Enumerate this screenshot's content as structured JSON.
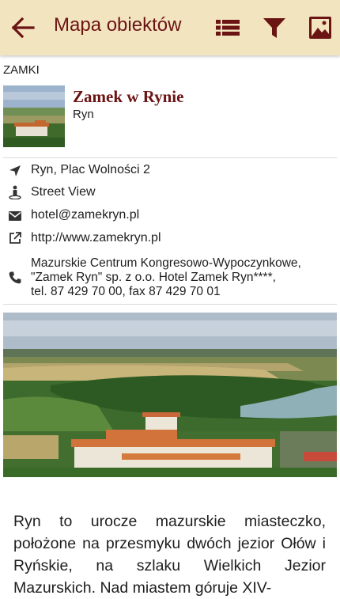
{
  "appbar": {
    "title": "Mapa obiektów",
    "back_icon": "arrow-back-icon",
    "actions": [
      "list-icon",
      "filter-icon",
      "map-image-icon"
    ],
    "bg_color": "#f3e4c0",
    "accent_color": "#6b1414"
  },
  "category": "ZAMKI",
  "object": {
    "name": "Zamek w Rynie",
    "town": "Ryn"
  },
  "info": {
    "address": "Ryn, Plac Wolności 2",
    "street_view": "Street View",
    "email": "hotel@zamekryn.pl",
    "website": "http://www.zamekryn.pl",
    "contact_lines": [
      "Mazurskie Centrum Kongresowo-Wypoczynkowe,",
      "\"Zamek Ryn\" sp. z o.o. Hotel Zamek Ryn****,",
      "tel. 87 429 70 00, fax 87 429 70 01"
    ]
  },
  "description": "Ryn to urocze mazurskie miasteczko, położone na przesmyku dwóch jezior Ołów i Ryńskie, na szlaku Wielkich Jezior Mazurskich. Nad miastem góruje XIV-"
}
